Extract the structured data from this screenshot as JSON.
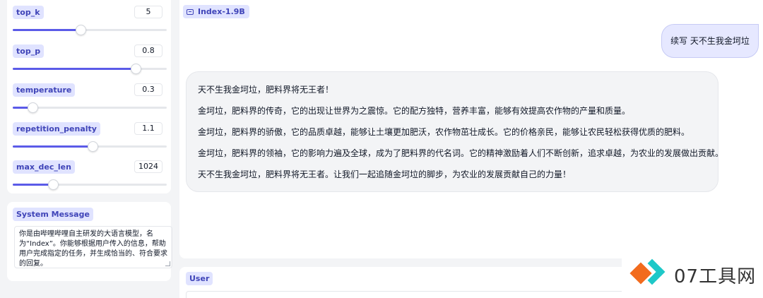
{
  "params": [
    {
      "label": "top_k",
      "value": "5",
      "fill": 0.44
    },
    {
      "label": "top_p",
      "value": "0.8",
      "fill": 0.8
    },
    {
      "label": "temperature",
      "value": "0.3",
      "fill": 0.13
    },
    {
      "label": "repetition_penalty",
      "value": "1.1",
      "fill": 0.52
    },
    {
      "label": "max_dec_len",
      "value": "1024",
      "fill": 0.26
    }
  ],
  "system": {
    "label": "System Message",
    "text": "你是由哔哩哔哩自主研发的大语言模型，名为“Index”。你能够根据用户传入的信息，帮助用户完成指定的任务，并生成恰当的、符合要求的回复。"
  },
  "chat": {
    "tag": "Index-1.9B",
    "tag_icon": "chat-icon",
    "user_message": "续写 天不生我金坷垃",
    "bot_lines": [
      "天不生我金坷垃，肥料界将无王者！",
      "金坷垃，肥料界的传奇，它的出现让世界为之震惊。它的配方独特，营养丰富，能够有效提高农作物的产量和质量。",
      "金坷垃，肥料界的骄傲，它的品质卓越，能够让土壤更加肥沃，农作物茁壮成长。它的价格亲民，能够让农民轻松获得优质的肥料。",
      "金坷垃，肥料界的领袖，它的影响力遍及全球，成为了肥料界的代名词。它的精神激励着人们不断创新，追求卓越，为农业的发展做出贡献。",
      "天不生我金坷垃，肥料界将无王者。让我们一起追随金坷垃的脚步，为农业的发展贡献自己的力量！"
    ]
  },
  "input": {
    "label": "User"
  },
  "watermark": {
    "text": "07工具网"
  },
  "colors": {
    "accent": "#5b5be8",
    "tag_bg": "#e0e3ff",
    "tag_text": "#3f44b8",
    "logo_orange": "#f26b1d",
    "logo_teal": "#1ec8c8"
  }
}
